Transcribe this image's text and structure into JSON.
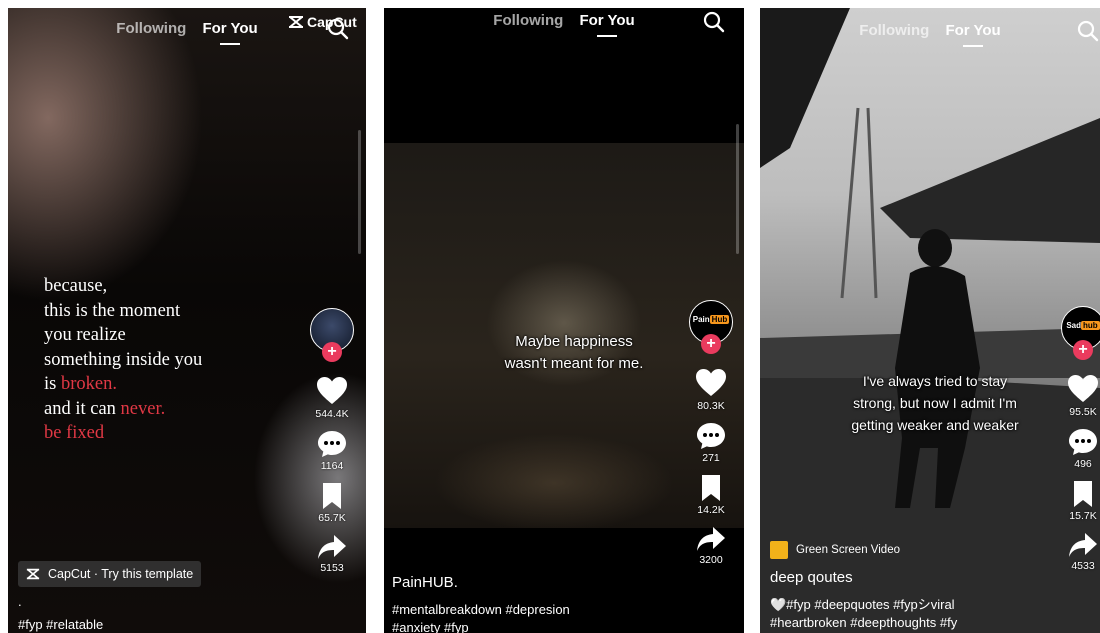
{
  "nav": {
    "following": "Following",
    "for_you": "For You"
  },
  "capcut_watermark": "CapCut",
  "panels": [
    {
      "caption_lines": [
        "because,",
        "this is the moment",
        "you realize",
        "something inside you"
      ],
      "caption_is": "is",
      "caption_broken": "broken.",
      "caption_and": "and it can",
      "caption_never": "never.",
      "caption_fixed": "be fixed",
      "likes": "544.4K",
      "comments": "1164",
      "saves": "65.7K",
      "shares": "5153",
      "template_pill": "CapCut · Try this template",
      "dot": ".",
      "hashtags": "#fyp #relatable"
    },
    {
      "avatar_text_top": "Pain",
      "avatar_text_bottom": "Hub",
      "caption_line1": "Maybe happiness",
      "caption_line2": "wasn't meant for me.",
      "likes": "80.3K",
      "comments": "271",
      "saves": "14.2K",
      "shares": "3200",
      "author": "PainHUB.",
      "hashtags_line1": "#mentalbreakdown #depresion",
      "hashtags_line2": "#anxiety #fyp"
    },
    {
      "avatar_text_top": "Sad",
      "avatar_text_bottom": "hub",
      "caption_line1": "I've always tried to stay",
      "caption_line2": "strong, but now I admit I'm",
      "caption_line3": "getting weaker and weaker",
      "likes": "95.5K",
      "comments": "496",
      "saves": "15.7K",
      "shares": "4533",
      "effect_label": "Green Screen Video",
      "author": "deep qoutes",
      "hashtags_line1": "🤍#fyp #deepquotes #fypシviral",
      "hashtags_line2": "#heartbroken #deepthoughts #fy"
    }
  ],
  "icons": {
    "search": "search-icon",
    "heart": "heart-icon",
    "comment": "comment-icon",
    "bookmark": "bookmark-icon",
    "share": "share-icon",
    "capcut": "capcut-icon"
  },
  "colors": {
    "accent_red": "#e13845",
    "plus_pink": "#ea3b5e",
    "hub_orange": "#f7971d"
  }
}
